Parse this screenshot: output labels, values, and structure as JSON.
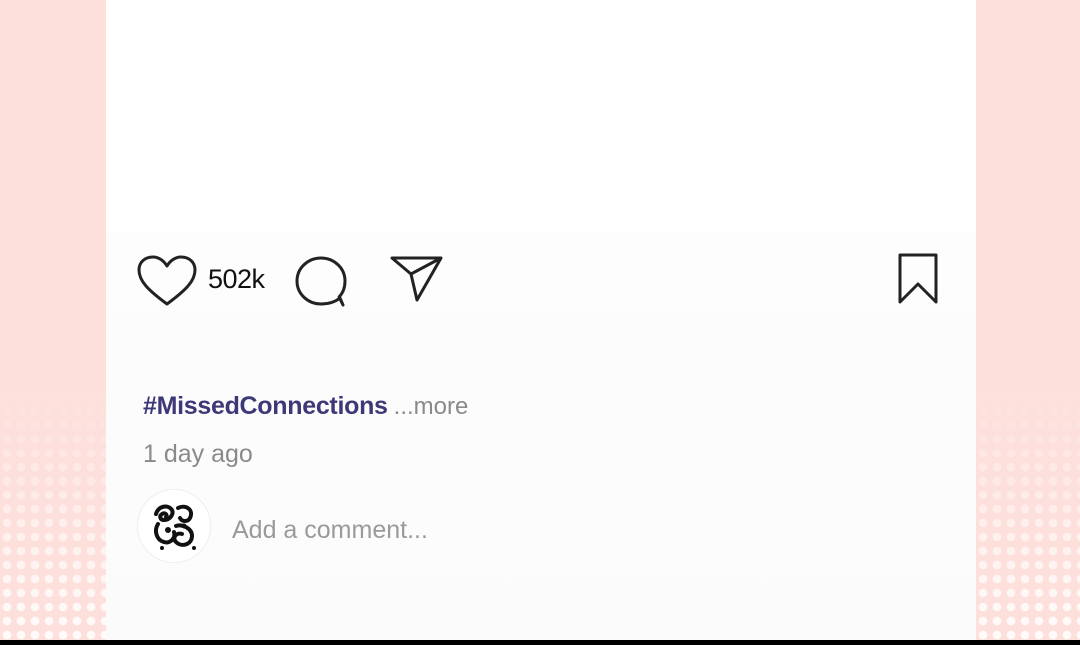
{
  "post": {
    "like_count": "502k",
    "caption_hashtag": "#MissedConnections",
    "caption_more": "...more",
    "timestamp": "1 day ago"
  },
  "comment": {
    "placeholder": "Add a comment..."
  },
  "icons": {
    "like": "heart-icon",
    "comment": "comment-bubble-icon",
    "share": "send-icon",
    "save": "bookmark-icon",
    "avatar": "user-avatar"
  },
  "colors": {
    "background": "#fde0db",
    "panel": "#ffffff",
    "hashtag": "#3d3877",
    "muted_text": "#8a8a8a",
    "icon_stroke": "#222222"
  }
}
